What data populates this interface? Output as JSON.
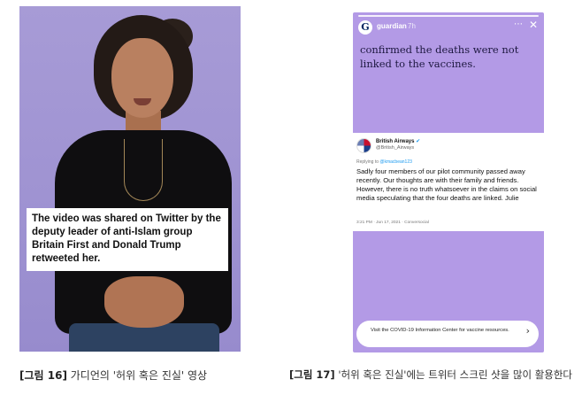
{
  "figure16": {
    "caption_text": "The video was shared on Twitter by the deputy leader of anti-Islam group Britain First and Donald Trump retweeted her.",
    "label_number": "[그림 16]",
    "label_text": " 가디언의 '허위 혹은 진실' 영상"
  },
  "figure17": {
    "story": {
      "account": "guardian",
      "time": "7h",
      "avatar_glyph": "G",
      "more_icon": "⋯",
      "close_icon": "✕",
      "headline": "confirmed the deaths were not linked to the vaccines.",
      "tweet": {
        "name": "British Airways",
        "verified_icon": "✔",
        "handle": "@British_Airways",
        "replying_prefix": "Replying to ",
        "replying_handle": "@kmacbean123",
        "body": "Sadly four members of our pilot community passed away recently. Our thoughts are with their family and friends. However, there is no truth whatsoever in the claims on social media speculating that the four deaths are linked. Julie",
        "meta": "3:21 PM · Jun 17, 2021 · Conversocial"
      },
      "info_pill": {
        "text": "Visit the COVID-19 Information Center for vaccine resources.",
        "arrow_icon": "›"
      }
    },
    "label_number": "[그림 17]",
    "label_text": " '허위 혹은 진실'에는 트위터 스크린 샷을 많이 활용한다"
  },
  "colors": {
    "video_background": "#a79bd6",
    "story_background": "#b39ae6",
    "headline_text": "#1d1840",
    "guardian_blue": "#052962",
    "twitter_blue": "#1d9bf0"
  }
}
